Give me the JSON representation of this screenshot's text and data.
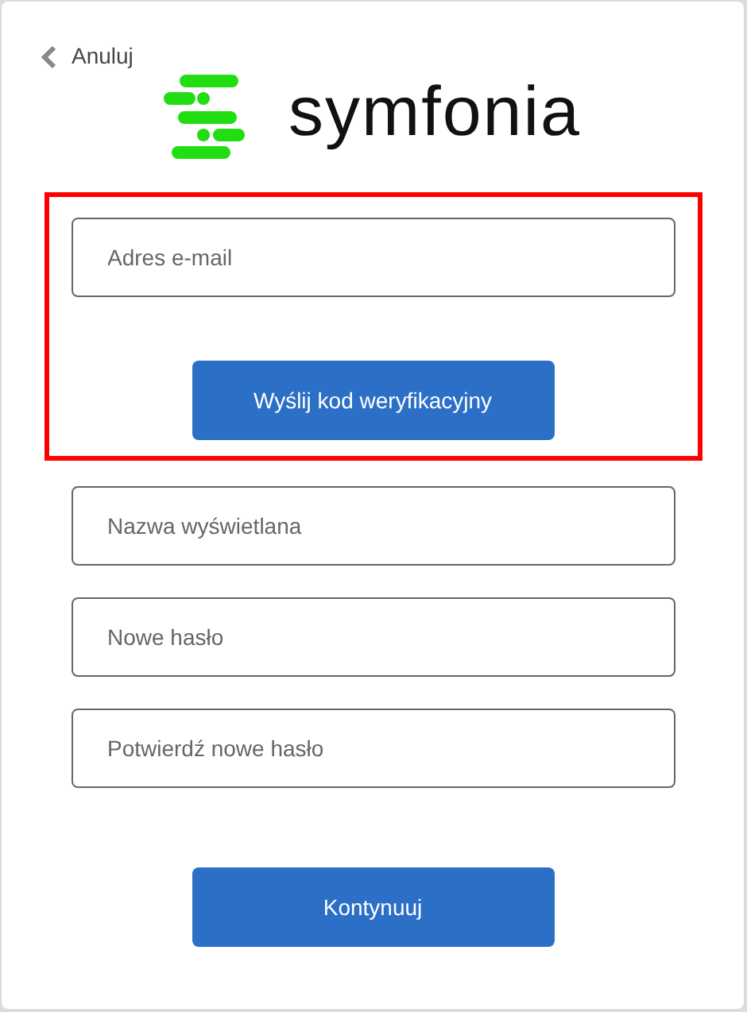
{
  "back_link": {
    "label": "Anuluj"
  },
  "logo": {
    "text": "symfonia"
  },
  "verification_section": {
    "highlighted": true,
    "email_field": {
      "placeholder": "Adres e-mail"
    },
    "send_button": {
      "label": "Wyślij kod weryfikacyjny"
    }
  },
  "fields": [
    {
      "placeholder": "Nazwa wyświetlana"
    },
    {
      "placeholder": "Nowe hasło"
    },
    {
      "placeholder": "Potwierdź nowe hasło"
    }
  ],
  "continue_button": {
    "label": "Kontynuuj"
  }
}
